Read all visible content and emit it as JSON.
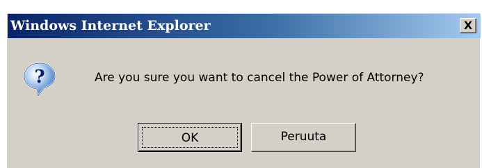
{
  "window": {
    "title": "Windows Internet Explorer",
    "close_label": "X"
  },
  "dialog": {
    "icon": "question-icon",
    "message": "Are you sure you want to cancel the Power of Attorney?",
    "ok_label": "OK",
    "cancel_label": "Peruuta"
  },
  "colors": {
    "titlebar_start": "#0a246a",
    "titlebar_end": "#a6caf0",
    "dialog_background": "#d4d0c8"
  }
}
